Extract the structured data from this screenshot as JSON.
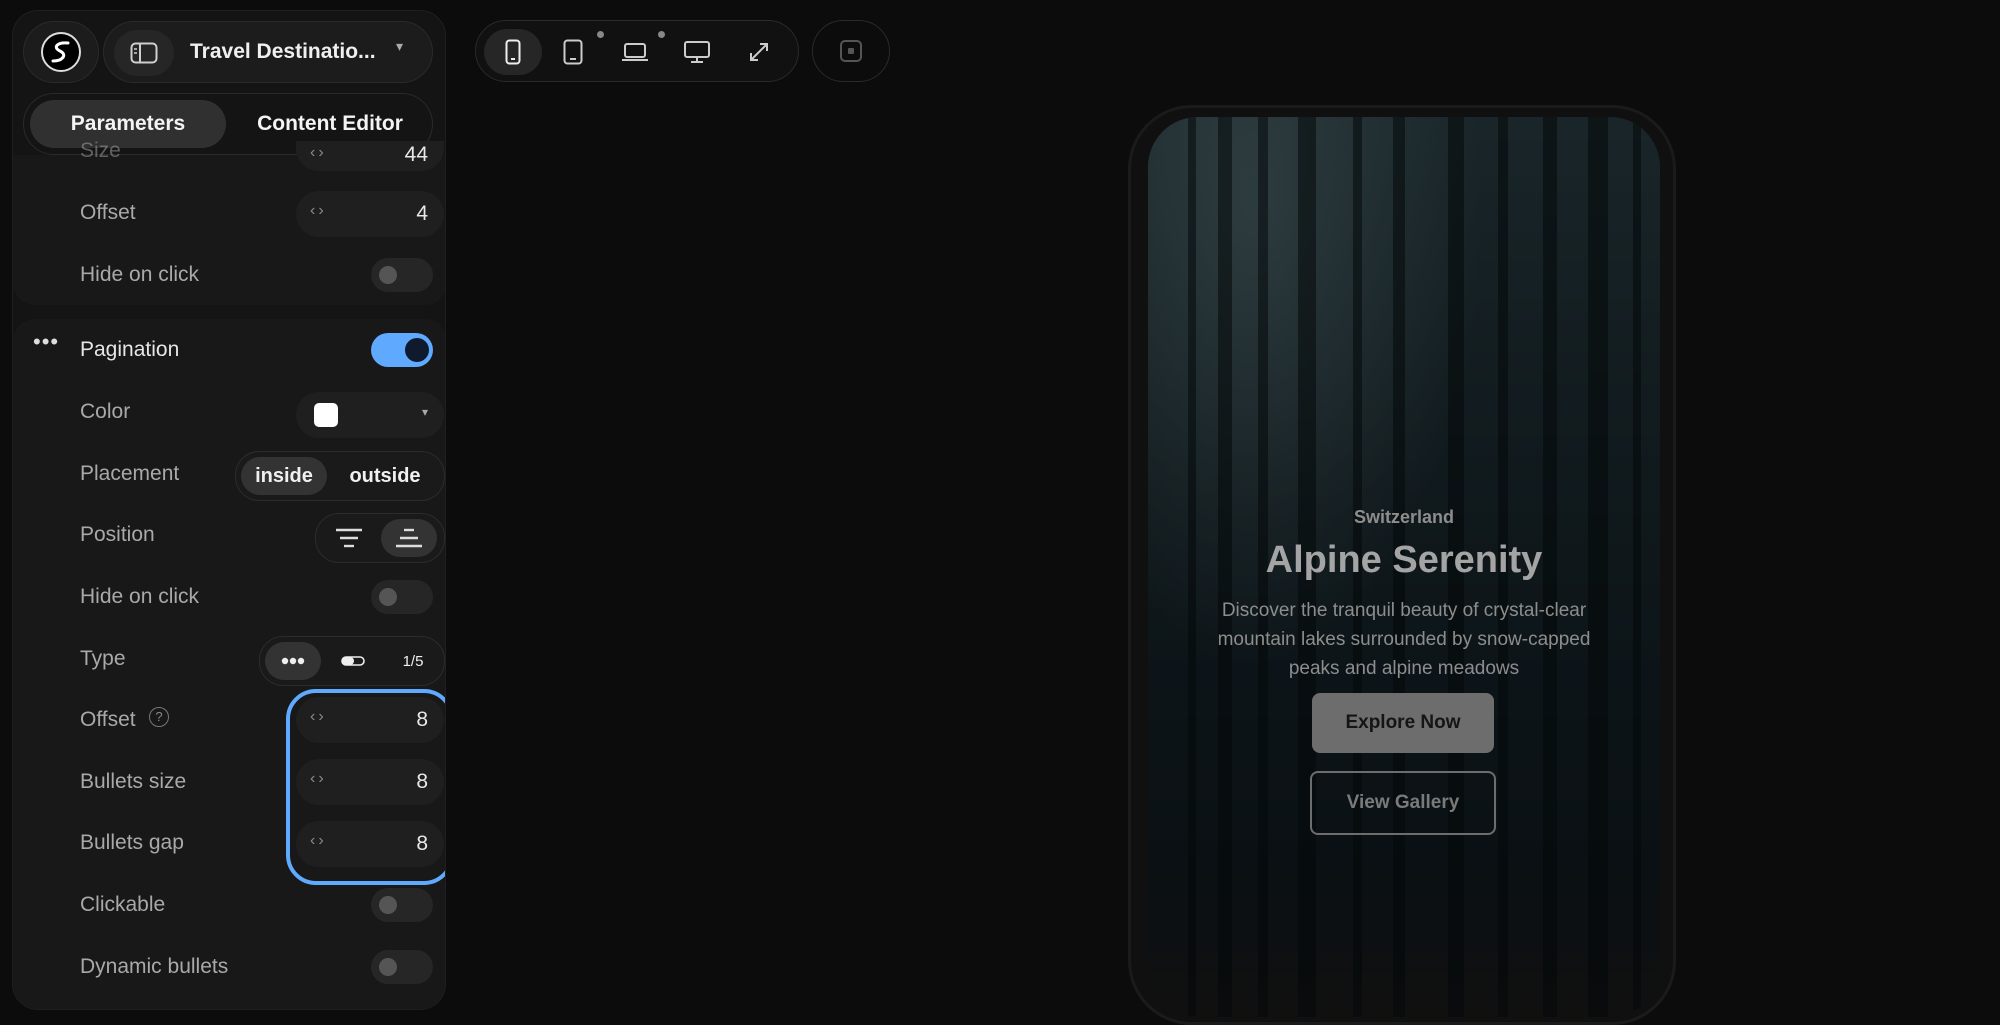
{
  "header": {
    "project_title": "Travel Destinatio...",
    "tabs": [
      "Parameters",
      "Content Editor"
    ]
  },
  "params": {
    "size_label": "Size",
    "size_value": "44",
    "offset_label": "Offset",
    "offset_value": "4",
    "hide_on_click_label": "Hide on click"
  },
  "pagination": {
    "section_label": "Pagination",
    "enabled": true,
    "color_label": "Color",
    "color_value": "#ffffff",
    "placement_label": "Placement",
    "placement_options": [
      "inside",
      "outside"
    ],
    "placement_selected": "inside",
    "position_label": "Position",
    "hide_on_click_label": "Hide on click",
    "type_label": "Type",
    "type_fraction": "1/5",
    "offset_label": "Offset",
    "offset_value": "8",
    "bullets_size_label": "Bullets size",
    "bullets_size_value": "8",
    "bullets_gap_label": "Bullets gap",
    "bullets_gap_value": "8",
    "clickable_label": "Clickable",
    "dynamic_bullets_label": "Dynamic bullets"
  },
  "preview": {
    "eyebrow": "Switzerland",
    "title": "Alpine Serenity",
    "description_lines": [
      "Discover the tranquil beauty of crystal-clear",
      "mountain lakes surrounded by snow-capped",
      "peaks and alpine meadows"
    ],
    "primary_button": "Explore Now",
    "secondary_button": "View Gallery"
  },
  "colors": {
    "accent": "#5fa9ff",
    "background": "#0c0c0c"
  }
}
